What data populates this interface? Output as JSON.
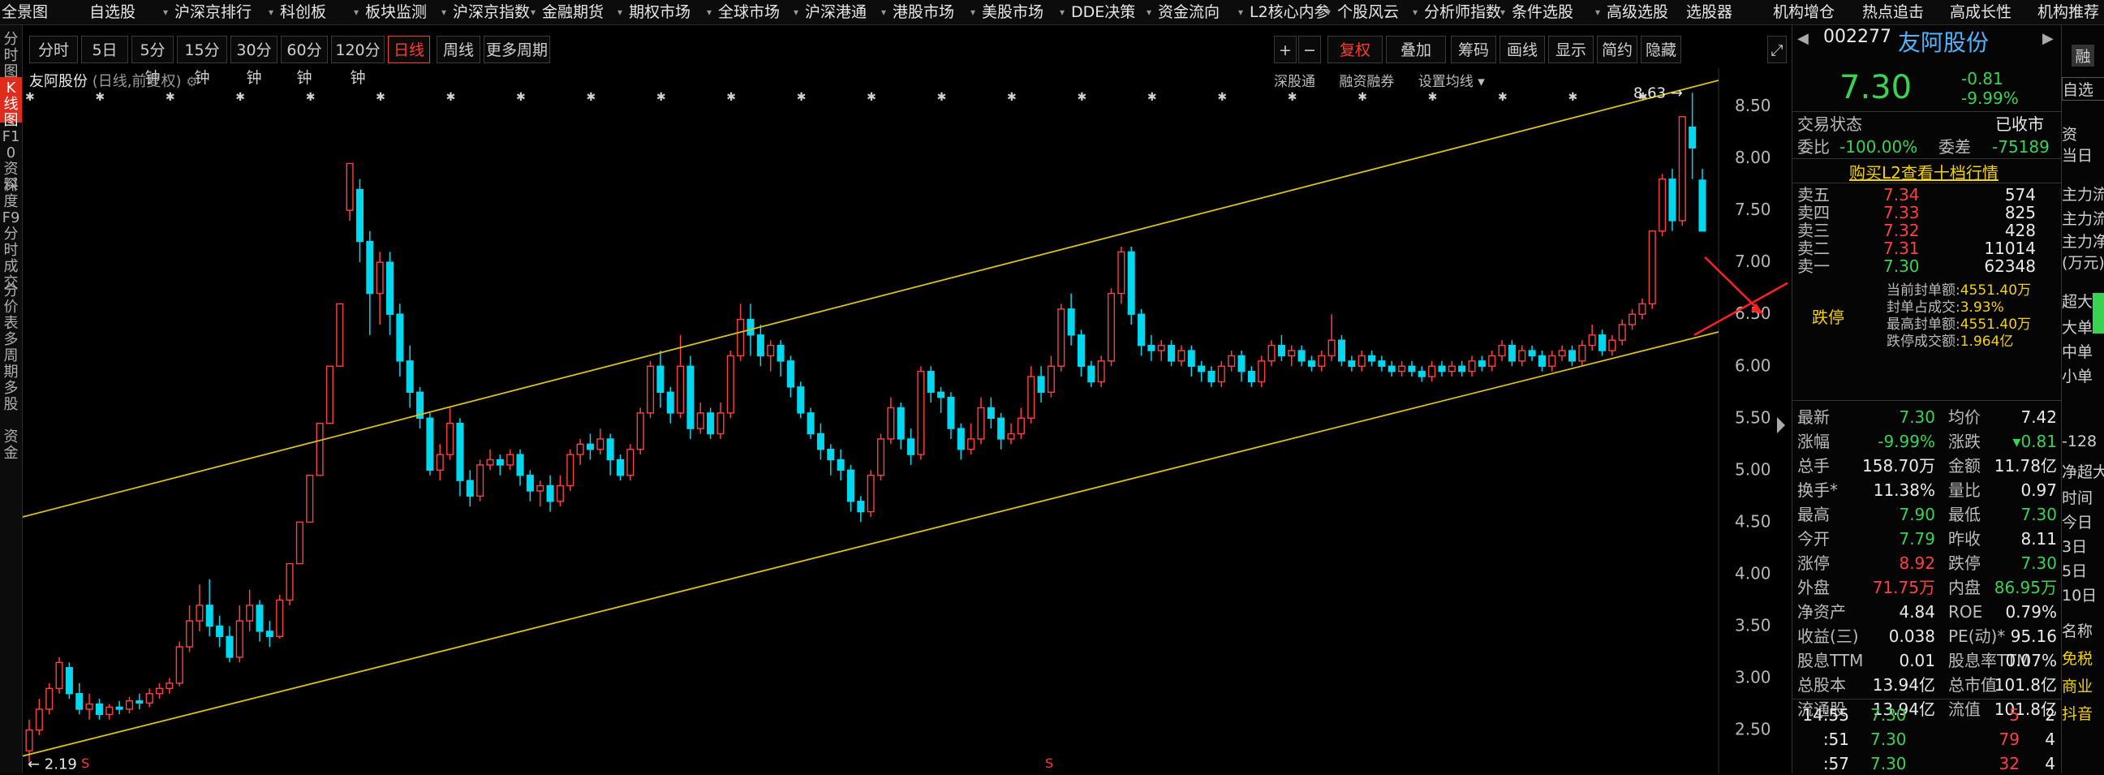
{
  "nav": [
    "全景图",
    "自选股",
    "沪深京排行",
    "科创板",
    "板块监测",
    "沪深京指数",
    "金融期货",
    "期权市场",
    "全球市场",
    "沪深港通",
    "港股市场",
    "美股市场",
    "DDE决策",
    "资金流向",
    "L2核心内参",
    "个股风云",
    "分析师指数",
    "条件选股",
    "高级选股",
    "选股器",
    "机构增仓",
    "热点追击",
    "高成长性",
    "机构推荐"
  ],
  "rail": [
    "分时图",
    "K线图",
    "F10资料",
    "深度F9",
    "分时成交",
    "分价表",
    "多周期",
    "多股",
    "资金"
  ],
  "toolbar": {
    "periods": [
      "分时",
      "5日",
      "5分钟",
      "15分钟",
      "30分钟",
      "60分钟",
      "120分钟",
      "日线",
      "周线",
      "更多周期"
    ],
    "active_period": "日线",
    "right": [
      "+",
      "−",
      "复权",
      "叠加",
      "筹码",
      "画线",
      "显示",
      "简约",
      "隐藏"
    ]
  },
  "chart_header": {
    "name": "友阿股份",
    "desc": "(日线,前复权)",
    "tools": [
      "深股通",
      "融资融券",
      "设置均线"
    ]
  },
  "chart_data": {
    "type": "candlestick",
    "y_ticks": [
      "8.50",
      "8.00",
      "7.50",
      "7.00",
      "6.50",
      "6.00",
      "5.50",
      "5.00",
      "4.50",
      "4.00",
      "3.50",
      "3.00",
      "2.50"
    ],
    "ylim": [
      2.2,
      8.75
    ],
    "high_label": "8.63",
    "low_label": "2.19",
    "candles": [
      {
        "o": 2.3,
        "c": 2.5,
        "h": 2.6,
        "l": 2.19
      },
      {
        "o": 2.5,
        "c": 2.7,
        "h": 2.8,
        "l": 2.45
      },
      {
        "o": 2.7,
        "c": 2.9,
        "h": 2.95,
        "l": 2.65
      },
      {
        "o": 2.9,
        "c": 3.15,
        "h": 3.2,
        "l": 2.85
      },
      {
        "o": 3.1,
        "c": 2.85,
        "h": 3.15,
        "l": 2.8
      },
      {
        "o": 2.85,
        "c": 2.7,
        "h": 2.95,
        "l": 2.65
      },
      {
        "o": 2.7,
        "c": 2.75,
        "h": 2.85,
        "l": 2.6
      },
      {
        "o": 2.75,
        "c": 2.65,
        "h": 2.8,
        "l": 2.6
      },
      {
        "o": 2.65,
        "c": 2.72,
        "h": 2.75,
        "l": 2.6
      },
      {
        "o": 2.72,
        "c": 2.7,
        "h": 2.78,
        "l": 2.65
      },
      {
        "o": 2.7,
        "c": 2.78,
        "h": 2.82,
        "l": 2.66
      },
      {
        "o": 2.78,
        "c": 2.76,
        "h": 2.85,
        "l": 2.7
      },
      {
        "o": 2.76,
        "c": 2.85,
        "h": 2.9,
        "l": 2.72
      },
      {
        "o": 2.85,
        "c": 2.9,
        "h": 2.95,
        "l": 2.8
      },
      {
        "o": 2.9,
        "c": 2.95,
        "h": 3.0,
        "l": 2.85
      },
      {
        "o": 2.95,
        "c": 3.3,
        "h": 3.35,
        "l": 2.92
      },
      {
        "o": 3.3,
        "c": 3.55,
        "h": 3.7,
        "l": 3.25
      },
      {
        "o": 3.55,
        "c": 3.7,
        "h": 3.9,
        "l": 3.45
      },
      {
        "o": 3.7,
        "c": 3.5,
        "h": 3.95,
        "l": 3.4
      },
      {
        "o": 3.5,
        "c": 3.4,
        "h": 3.6,
        "l": 3.3
      },
      {
        "o": 3.4,
        "c": 3.2,
        "h": 3.5,
        "l": 3.15
      },
      {
        "o": 3.2,
        "c": 3.55,
        "h": 3.7,
        "l": 3.15
      },
      {
        "o": 3.55,
        "c": 3.7,
        "h": 3.85,
        "l": 3.45
      },
      {
        "o": 3.7,
        "c": 3.45,
        "h": 3.75,
        "l": 3.35
      },
      {
        "o": 3.45,
        "c": 3.4,
        "h": 3.55,
        "l": 3.3
      },
      {
        "o": 3.4,
        "c": 3.75,
        "h": 3.8,
        "l": 3.38
      },
      {
        "o": 3.75,
        "c": 4.1,
        "h": 4.1,
        "l": 3.7
      },
      {
        "o": 4.1,
        "c": 4.5,
        "h": 4.5,
        "l": 4.1
      },
      {
        "o": 4.5,
        "c": 4.95,
        "h": 4.95,
        "l": 4.5
      },
      {
        "o": 4.95,
        "c": 5.45,
        "h": 5.45,
        "l": 4.95
      },
      {
        "o": 5.45,
        "c": 6.0,
        "h": 6.0,
        "l": 5.45
      },
      {
        "o": 6.0,
        "c": 6.6,
        "h": 6.6,
        "l": 6.0
      },
      {
        "o": 7.5,
        "c": 7.95,
        "h": 7.95,
        "l": 7.4
      },
      {
        "o": 7.7,
        "c": 7.2,
        "h": 7.8,
        "l": 7.0
      },
      {
        "o": 7.2,
        "c": 6.7,
        "h": 7.3,
        "l": 6.3
      },
      {
        "o": 6.7,
        "c": 7.0,
        "h": 7.1,
        "l": 6.4
      },
      {
        "o": 7.0,
        "c": 6.5,
        "h": 7.1,
        "l": 6.3
      },
      {
        "o": 6.5,
        "c": 6.05,
        "h": 6.6,
        "l": 5.9
      },
      {
        "o": 6.05,
        "c": 5.75,
        "h": 6.2,
        "l": 5.6
      },
      {
        "o": 5.75,
        "c": 5.5,
        "h": 5.8,
        "l": 5.4
      },
      {
        "o": 5.5,
        "c": 5.0,
        "h": 5.55,
        "l": 4.95
      },
      {
        "o": 5.0,
        "c": 5.15,
        "h": 5.25,
        "l": 4.9
      },
      {
        "o": 5.15,
        "c": 5.45,
        "h": 5.6,
        "l": 5.1
      },
      {
        "o": 5.45,
        "c": 4.9,
        "h": 5.5,
        "l": 4.75
      },
      {
        "o": 4.9,
        "c": 4.75,
        "h": 5.0,
        "l": 4.65
      },
      {
        "o": 4.75,
        "c": 5.05,
        "h": 5.1,
        "l": 4.7
      },
      {
        "o": 5.05,
        "c": 5.1,
        "h": 5.2,
        "l": 5.0
      },
      {
        "o": 5.1,
        "c": 5.05,
        "h": 5.15,
        "l": 4.95
      },
      {
        "o": 5.05,
        "c": 5.15,
        "h": 5.2,
        "l": 5.0
      },
      {
        "o": 5.15,
        "c": 4.95,
        "h": 5.2,
        "l": 4.85
      },
      {
        "o": 4.95,
        "c": 4.8,
        "h": 5.0,
        "l": 4.7
      },
      {
        "o": 4.8,
        "c": 4.85,
        "h": 4.9,
        "l": 4.65
      },
      {
        "o": 4.85,
        "c": 4.7,
        "h": 4.95,
        "l": 4.6
      },
      {
        "o": 4.7,
        "c": 4.85,
        "h": 4.95,
        "l": 4.65
      },
      {
        "o": 4.85,
        "c": 5.15,
        "h": 5.2,
        "l": 4.8
      },
      {
        "o": 5.15,
        "c": 5.25,
        "h": 5.3,
        "l": 5.05
      },
      {
        "o": 5.25,
        "c": 5.2,
        "h": 5.35,
        "l": 5.1
      },
      {
        "o": 5.2,
        "c": 5.3,
        "h": 5.4,
        "l": 5.15
      },
      {
        "o": 5.3,
        "c": 5.1,
        "h": 5.35,
        "l": 4.95
      },
      {
        "o": 5.1,
        "c": 4.95,
        "h": 5.15,
        "l": 4.9
      },
      {
        "o": 4.95,
        "c": 5.2,
        "h": 5.25,
        "l": 4.9
      },
      {
        "o": 5.2,
        "c": 5.55,
        "h": 5.6,
        "l": 5.15
      },
      {
        "o": 5.55,
        "c": 6.0,
        "h": 6.05,
        "l": 5.5
      },
      {
        "o": 6.0,
        "c": 5.75,
        "h": 6.15,
        "l": 5.6
      },
      {
        "o": 5.75,
        "c": 5.55,
        "h": 5.8,
        "l": 5.45
      },
      {
        "o": 5.55,
        "c": 6.0,
        "h": 6.3,
        "l": 5.5
      },
      {
        "o": 6.0,
        "c": 5.4,
        "h": 6.1,
        "l": 5.3
      },
      {
        "o": 5.4,
        "c": 5.55,
        "h": 5.65,
        "l": 5.35
      },
      {
        "o": 5.55,
        "c": 5.35,
        "h": 5.6,
        "l": 5.3
      },
      {
        "o": 5.35,
        "c": 5.55,
        "h": 5.65,
        "l": 5.3
      },
      {
        "o": 5.55,
        "c": 6.1,
        "h": 6.15,
        "l": 5.5
      },
      {
        "o": 6.1,
        "c": 6.45,
        "h": 6.6,
        "l": 6.05
      },
      {
        "o": 6.45,
        "c": 6.3,
        "h": 6.6,
        "l": 6.1
      },
      {
        "o": 6.3,
        "c": 6.1,
        "h": 6.4,
        "l": 6.0
      },
      {
        "o": 6.1,
        "c": 6.2,
        "h": 6.25,
        "l": 5.95
      },
      {
        "o": 6.2,
        "c": 6.05,
        "h": 6.25,
        "l": 5.9
      },
      {
        "o": 6.05,
        "c": 5.8,
        "h": 6.1,
        "l": 5.7
      },
      {
        "o": 5.8,
        "c": 5.55,
        "h": 5.85,
        "l": 5.5
      },
      {
        "o": 5.55,
        "c": 5.35,
        "h": 5.6,
        "l": 5.3
      },
      {
        "o": 5.35,
        "c": 5.2,
        "h": 5.45,
        "l": 5.1
      },
      {
        "o": 5.2,
        "c": 5.1,
        "h": 5.25,
        "l": 4.95
      },
      {
        "o": 5.1,
        "c": 5.0,
        "h": 5.2,
        "l": 4.9
      },
      {
        "o": 5.0,
        "c": 4.7,
        "h": 5.05,
        "l": 4.6
      },
      {
        "o": 4.7,
        "c": 4.6,
        "h": 4.75,
        "l": 4.5
      },
      {
        "o": 4.6,
        "c": 4.95,
        "h": 5.0,
        "l": 4.55
      },
      {
        "o": 4.95,
        "c": 5.3,
        "h": 5.35,
        "l": 4.9
      },
      {
        "o": 5.3,
        "c": 5.6,
        "h": 5.7,
        "l": 5.25
      },
      {
        "o": 5.6,
        "c": 5.3,
        "h": 5.65,
        "l": 5.2
      },
      {
        "o": 5.3,
        "c": 5.15,
        "h": 5.4,
        "l": 5.05
      },
      {
        "o": 5.15,
        "c": 5.95,
        "h": 6.0,
        "l": 5.1
      },
      {
        "o": 5.95,
        "c": 5.75,
        "h": 6.0,
        "l": 5.65
      },
      {
        "o": 5.75,
        "c": 5.7,
        "h": 5.8,
        "l": 5.55
      },
      {
        "o": 5.7,
        "c": 5.4,
        "h": 5.75,
        "l": 5.3
      },
      {
        "o": 5.4,
        "c": 5.2,
        "h": 5.45,
        "l": 5.1
      },
      {
        "o": 5.2,
        "c": 5.3,
        "h": 5.45,
        "l": 5.15
      },
      {
        "o": 5.3,
        "c": 5.6,
        "h": 5.7,
        "l": 5.25
      },
      {
        "o": 5.6,
        "c": 5.5,
        "h": 5.7,
        "l": 5.4
      },
      {
        "o": 5.5,
        "c": 5.3,
        "h": 5.55,
        "l": 5.2
      },
      {
        "o": 5.3,
        "c": 5.35,
        "h": 5.45,
        "l": 5.25
      },
      {
        "o": 5.35,
        "c": 5.5,
        "h": 5.6,
        "l": 5.3
      },
      {
        "o": 5.5,
        "c": 5.9,
        "h": 6.0,
        "l": 5.45
      },
      {
        "o": 5.9,
        "c": 5.75,
        "h": 6.0,
        "l": 5.65
      },
      {
        "o": 5.75,
        "c": 6.0,
        "h": 6.1,
        "l": 5.7
      },
      {
        "o": 6.0,
        "c": 6.55,
        "h": 6.6,
        "l": 5.95
      },
      {
        "o": 6.55,
        "c": 6.3,
        "h": 6.7,
        "l": 6.2
      },
      {
        "o": 6.3,
        "c": 6.0,
        "h": 6.35,
        "l": 5.9
      },
      {
        "o": 6.0,
        "c": 5.85,
        "h": 6.05,
        "l": 5.8
      },
      {
        "o": 5.85,
        "c": 6.05,
        "h": 6.1,
        "l": 5.8
      },
      {
        "o": 6.05,
        "c": 6.7,
        "h": 6.75,
        "l": 6.0
      },
      {
        "o": 6.7,
        "c": 7.1,
        "h": 7.15,
        "l": 6.6
      },
      {
        "o": 7.1,
        "c": 6.5,
        "h": 7.15,
        "l": 6.4
      },
      {
        "o": 6.5,
        "c": 6.2,
        "h": 6.55,
        "l": 6.1
      },
      {
        "o": 6.2,
        "c": 6.15,
        "h": 6.3,
        "l": 6.05
      },
      {
        "o": 6.15,
        "c": 6.2,
        "h": 6.25,
        "l": 6.05
      },
      {
        "o": 6.2,
        "c": 6.05,
        "h": 6.25,
        "l": 6.0
      },
      {
        "o": 6.05,
        "c": 6.15,
        "h": 6.2,
        "l": 6.0
      },
      {
        "o": 6.15,
        "c": 6.0,
        "h": 6.2,
        "l": 5.9
      },
      {
        "o": 6.0,
        "c": 5.95,
        "h": 6.05,
        "l": 5.85
      },
      {
        "o": 5.95,
        "c": 5.85,
        "h": 6.0,
        "l": 5.8
      },
      {
        "o": 5.85,
        "c": 6.0,
        "h": 6.05,
        "l": 5.8
      },
      {
        "o": 6.0,
        "c": 6.1,
        "h": 6.15,
        "l": 5.95
      },
      {
        "o": 6.1,
        "c": 5.95,
        "h": 6.15,
        "l": 5.85
      },
      {
        "o": 5.95,
        "c": 5.85,
        "h": 6.0,
        "l": 5.8
      },
      {
        "o": 5.85,
        "c": 6.05,
        "h": 6.1,
        "l": 5.8
      },
      {
        "o": 6.05,
        "c": 6.2,
        "h": 6.25,
        "l": 6.0
      },
      {
        "o": 6.2,
        "c": 6.1,
        "h": 6.3,
        "l": 6.05
      },
      {
        "o": 6.1,
        "c": 6.15,
        "h": 6.2,
        "l": 6.0
      },
      {
        "o": 6.15,
        "c": 6.05,
        "h": 6.2,
        "l": 6.0
      },
      {
        "o": 6.05,
        "c": 6.0,
        "h": 6.1,
        "l": 5.95
      },
      {
        "o": 6.0,
        "c": 6.1,
        "h": 6.15,
        "l": 5.95
      },
      {
        "o": 6.1,
        "c": 6.25,
        "h": 6.5,
        "l": 6.05
      },
      {
        "o": 6.25,
        "c": 6.05,
        "h": 6.3,
        "l": 6.0
      },
      {
        "o": 6.05,
        "c": 6.0,
        "h": 6.1,
        "l": 5.95
      },
      {
        "o": 6.0,
        "c": 6.1,
        "h": 6.15,
        "l": 5.95
      },
      {
        "o": 6.1,
        "c": 6.05,
        "h": 6.15,
        "l": 6.0
      },
      {
        "o": 6.05,
        "c": 6.0,
        "h": 6.1,
        "l": 5.95
      },
      {
        "o": 6.0,
        "c": 5.95,
        "h": 6.05,
        "l": 5.9
      },
      {
        "o": 5.95,
        "c": 6.0,
        "h": 6.05,
        "l": 5.9
      },
      {
        "o": 6.0,
        "c": 5.95,
        "h": 6.05,
        "l": 5.9
      },
      {
        "o": 5.95,
        "c": 5.9,
        "h": 6.0,
        "l": 5.85
      },
      {
        "o": 5.9,
        "c": 6.0,
        "h": 6.05,
        "l": 5.85
      },
      {
        "o": 6.0,
        "c": 5.95,
        "h": 6.05,
        "l": 5.9
      },
      {
        "o": 5.95,
        "c": 6.0,
        "h": 6.05,
        "l": 5.9
      },
      {
        "o": 6.0,
        "c": 5.95,
        "h": 6.05,
        "l": 5.9
      },
      {
        "o": 5.95,
        "c": 6.05,
        "h": 6.1,
        "l": 5.9
      },
      {
        "o": 6.05,
        "c": 6.0,
        "h": 6.1,
        "l": 5.95
      },
      {
        "o": 6.0,
        "c": 6.1,
        "h": 6.15,
        "l": 5.95
      },
      {
        "o": 6.1,
        "c": 6.2,
        "h": 6.25,
        "l": 6.05
      },
      {
        "o": 6.2,
        "c": 6.05,
        "h": 6.25,
        "l": 6.0
      },
      {
        "o": 6.05,
        "c": 6.15,
        "h": 6.2,
        "l": 6.0
      },
      {
        "o": 6.15,
        "c": 6.1,
        "h": 6.2,
        "l": 6.05
      },
      {
        "o": 6.1,
        "c": 6.0,
        "h": 6.15,
        "l": 5.95
      },
      {
        "o": 6.0,
        "c": 6.1,
        "h": 6.15,
        "l": 5.95
      },
      {
        "o": 6.1,
        "c": 6.15,
        "h": 6.2,
        "l": 6.05
      },
      {
        "o": 6.15,
        "c": 6.05,
        "h": 6.2,
        "l": 6.0
      },
      {
        "o": 6.05,
        "c": 6.2,
        "h": 6.25,
        "l": 6.0
      },
      {
        "o": 6.2,
        "c": 6.3,
        "h": 6.4,
        "l": 6.15
      },
      {
        "o": 6.3,
        "c": 6.15,
        "h": 6.35,
        "l": 6.1
      },
      {
        "o": 6.15,
        "c": 6.25,
        "h": 6.3,
        "l": 6.1
      },
      {
        "o": 6.25,
        "c": 6.4,
        "h": 6.45,
        "l": 6.2
      },
      {
        "o": 6.4,
        "c": 6.5,
        "h": 6.55,
        "l": 6.35
      },
      {
        "o": 6.5,
        "c": 6.6,
        "h": 6.65,
        "l": 6.45
      },
      {
        "o": 6.6,
        "c": 7.3,
        "h": 7.3,
        "l": 6.55
      },
      {
        "o": 7.3,
        "c": 7.8,
        "h": 7.85,
        "l": 7.25
      },
      {
        "o": 7.8,
        "c": 7.4,
        "h": 7.9,
        "l": 7.3
      },
      {
        "o": 7.4,
        "c": 8.4,
        "h": 8.4,
        "l": 7.35
      },
      {
        "o": 8.3,
        "c": 8.1,
        "h": 8.63,
        "l": 7.8
      },
      {
        "o": 7.79,
        "c": 7.3,
        "h": 7.9,
        "l": 7.3
      }
    ]
  },
  "stock": {
    "code": "002277",
    "name": "友阿股份",
    "price": "7.30",
    "change": "-0.81",
    "pct": "-9.99%",
    "status_label": "交易状态",
    "status": "已收市",
    "weibi_label": "委比",
    "weibi": "-100.00%",
    "weicha_label": "委差",
    "weicha": "-75189",
    "l2_link": "购买L2查看十档行情",
    "asks": [
      {
        "label": "卖五",
        "price": "7.34",
        "vol": "574"
      },
      {
        "label": "卖四",
        "price": "7.33",
        "vol": "825"
      },
      {
        "label": "卖三",
        "price": "7.32",
        "vol": "428"
      },
      {
        "label": "卖二",
        "price": "7.31",
        "vol": "11014"
      },
      {
        "label": "卖一",
        "price": "7.30",
        "vol": "62348"
      }
    ],
    "limit_down_label": "跌停",
    "seal": [
      {
        "label": "当前封单额:",
        "value": "4551.40万"
      },
      {
        "label": "封单占成交:",
        "value": "3.93%"
      },
      {
        "label": "最高封单额:",
        "value": "4551.40万"
      },
      {
        "label": "跌停成交额:",
        "value": "1.964亿"
      }
    ],
    "stats": [
      [
        "最新",
        "7.30",
        "均价",
        "7.42"
      ],
      [
        "涨幅",
        "-9.99%",
        "涨跌",
        "▾0.81"
      ],
      [
        "总手",
        "158.70万",
        "金额",
        "11.78亿"
      ],
      [
        "换手*",
        "11.38%",
        "量比",
        "0.97"
      ],
      [
        "最高",
        "7.90",
        "最低",
        "7.30"
      ],
      [
        "今开",
        "7.79",
        "昨收",
        "8.11"
      ],
      [
        "涨停",
        "8.92",
        "跌停",
        "7.30"
      ],
      [
        "外盘",
        "71.75万",
        "内盘",
        "86.95万"
      ],
      [
        "净资产",
        "4.84",
        "ROE",
        "0.79%"
      ],
      [
        "收益(三)",
        "0.038",
        "PE(动)*",
        "95.16"
      ],
      [
        "股息TTM",
        "0.01",
        "股息率TTM",
        "0.07%"
      ],
      [
        "总股本",
        "13.94亿",
        "总市值",
        "101.8亿"
      ],
      [
        "流通股",
        "13.94亿",
        "流值",
        "101.8亿"
      ]
    ],
    "trades": [
      {
        "time": "14:55",
        "price": "7.30",
        "vol": "5",
        "n": "2"
      },
      {
        "time": ":51",
        "price": "7.30",
        "vol": "79",
        "n": "4"
      },
      {
        "time": ":57",
        "price": "7.30",
        "vol": "32",
        "n": "4"
      }
    ]
  },
  "far_right": [
    "融",
    "自选",
    "资",
    "当日",
    "主力流",
    "主力流",
    "主力净",
    "(万元)",
    "超大",
    "大单",
    "中单",
    "小单",
    "-128",
    "净超大",
    "时间",
    "今日",
    "3日",
    "5日",
    "10日",
    "名称",
    "免税",
    "商业",
    "抖音"
  ],
  "colors": {
    "up": "#ff4040",
    "down": "#00d8f0",
    "channel": "#d8c21a",
    "arrow": "#ff2020"
  }
}
